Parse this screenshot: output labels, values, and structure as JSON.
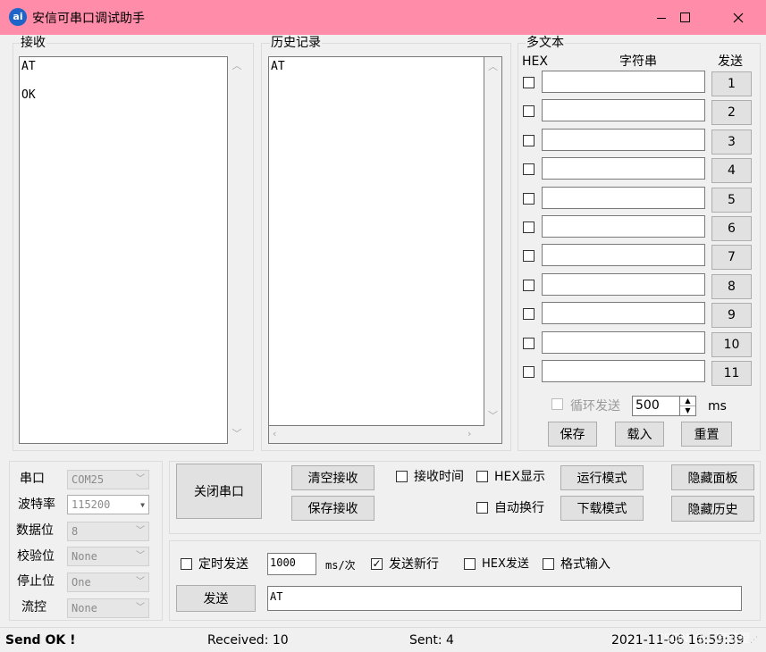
{
  "window": {
    "title": "安信可串口调试助手",
    "app_icon_text": "ai"
  },
  "receive": {
    "label": "接收",
    "content": "AT\n\nOK"
  },
  "history": {
    "label": "历史记录",
    "content": "AT"
  },
  "multitext": {
    "label": "多文本",
    "col_hex": "HEX",
    "col_string": "字符串",
    "col_send": "发送",
    "rows": [
      {
        "label": "1"
      },
      {
        "label": "2"
      },
      {
        "label": "3"
      },
      {
        "label": "4"
      },
      {
        "label": "5"
      },
      {
        "label": "6"
      },
      {
        "label": "7"
      },
      {
        "label": "8"
      },
      {
        "label": "9"
      },
      {
        "label": "10"
      },
      {
        "label": "11"
      }
    ],
    "loop_send_label": "循环发送",
    "loop_interval": "500",
    "loop_unit": "ms",
    "save_label": "保存",
    "load_label": "载入",
    "reset_label": "重置"
  },
  "port_settings": {
    "port_label": "串口",
    "port_value": "COM25",
    "baud_label": "波特率",
    "baud_value": "115200",
    "databits_label": "数据位",
    "databits_value": "8",
    "parity_label": "校验位",
    "parity_value": "None",
    "stopbits_label": "停止位",
    "stopbits_value": "One",
    "flow_label": "流控",
    "flow_value": "None"
  },
  "controls": {
    "close_port": "关闭串口",
    "clear_receive": "清空接收",
    "save_receive": "保存接收",
    "recv_time": "接收时间",
    "hex_display": "HEX显示",
    "auto_newline": "自动换行",
    "run_mode": "运行模式",
    "download_mode": "下载模式",
    "hide_panel": "隐藏面板",
    "hide_history": "隐藏历史"
  },
  "send_area": {
    "timed_send": "定时发送",
    "interval_value": "1000",
    "interval_unit": "ms/次",
    "send_newline": "发送新行",
    "hex_send": "HEX发送",
    "format_input": "格式输入",
    "send_button": "发送",
    "send_text": "AT"
  },
  "status": {
    "message": "Send OK !",
    "received": "Received: 10",
    "sent": "Sent: 4",
    "datetime": "2021-11-06 16:59:39",
    "watermark": "CSDN @上官菲夏"
  },
  "colors": {
    "titlebar": "#ff8ca8",
    "window_bg": "#f0f0f0"
  }
}
